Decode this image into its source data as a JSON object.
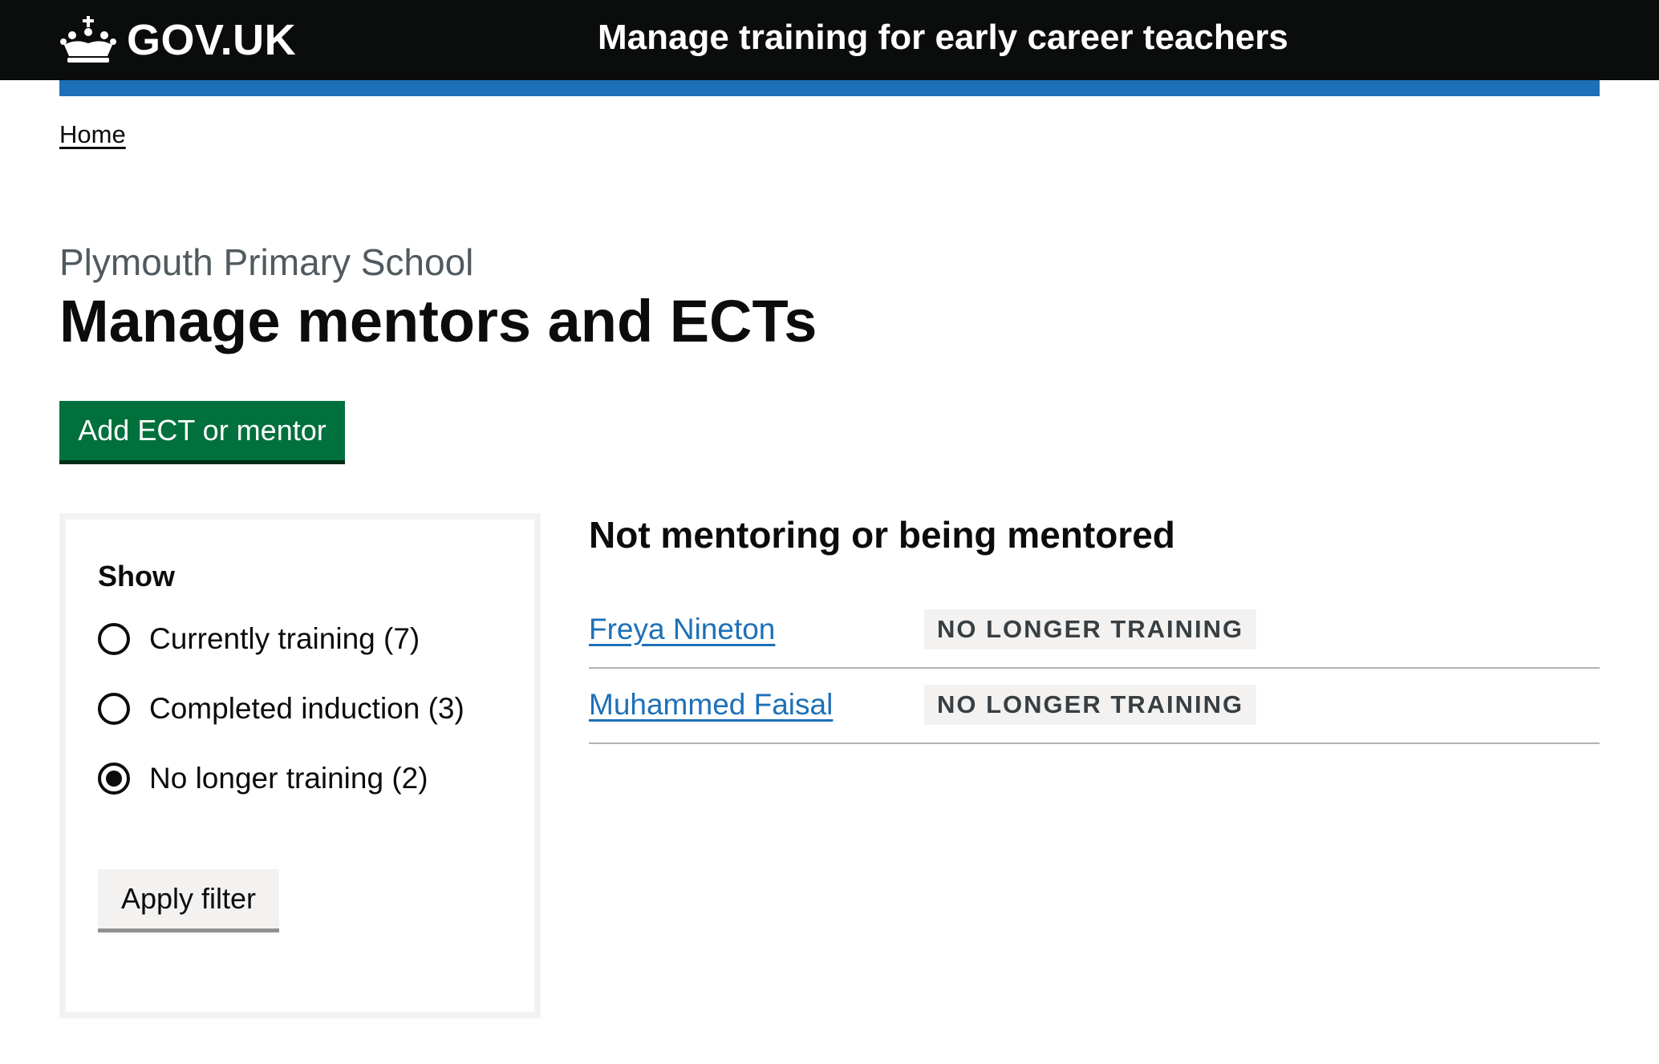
{
  "header": {
    "logo_text": "GOV.UK",
    "service_name": "Manage training for early career teachers"
  },
  "breadcrumb": {
    "home": "Home"
  },
  "page": {
    "caption": "Plymouth Primary School",
    "title": "Manage mentors and ECTs",
    "add_button_label": "Add ECT or mentor"
  },
  "filter": {
    "legend": "Show",
    "options": [
      {
        "label": "Currently training (7)",
        "selected": false
      },
      {
        "label": "Completed induction (3)",
        "selected": false
      },
      {
        "label": "No longer training (2)",
        "selected": true
      }
    ],
    "apply_label": "Apply filter"
  },
  "results": {
    "heading": "Not mentoring or being mentored",
    "rows": [
      {
        "name": "Freya Nineton",
        "status": "NO LONGER TRAINING"
      },
      {
        "name": "Muhammed Faisal",
        "status": "NO LONGER TRAINING"
      }
    ]
  },
  "colors": {
    "header_bg": "#0b0c0c",
    "brand_blue": "#1d70b8",
    "button_green": "#00703c",
    "tag_grey_bg": "#f3f2f1"
  }
}
